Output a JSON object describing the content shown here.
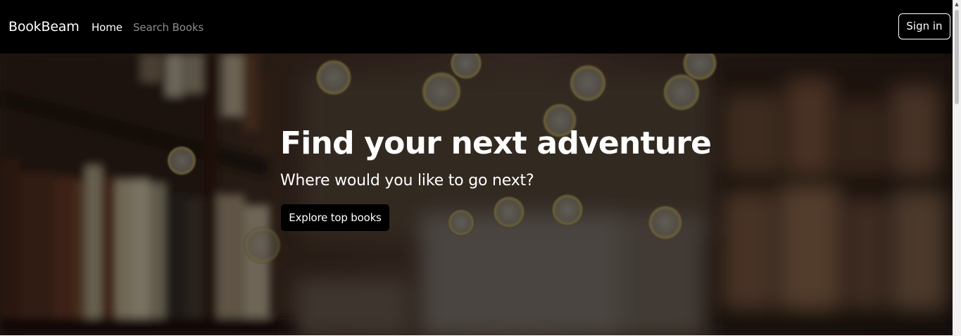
{
  "navbar": {
    "brand": "BookBeam",
    "links": [
      {
        "label": "Home",
        "active": true
      },
      {
        "label": "Search Books",
        "active": false
      }
    ],
    "signin_label": "Sign in"
  },
  "hero": {
    "title": "Find your next adventure",
    "subtitle": "Where would you like to go next?",
    "cta_label": "Explore top books"
  },
  "colors": {
    "navbar_bg": "#000000",
    "nav_active": "#ffffff",
    "nav_inactive": "#8c8c8c",
    "button_bg": "#000000"
  },
  "icons": {
    "scroll_up": "triangle-up-icon"
  }
}
